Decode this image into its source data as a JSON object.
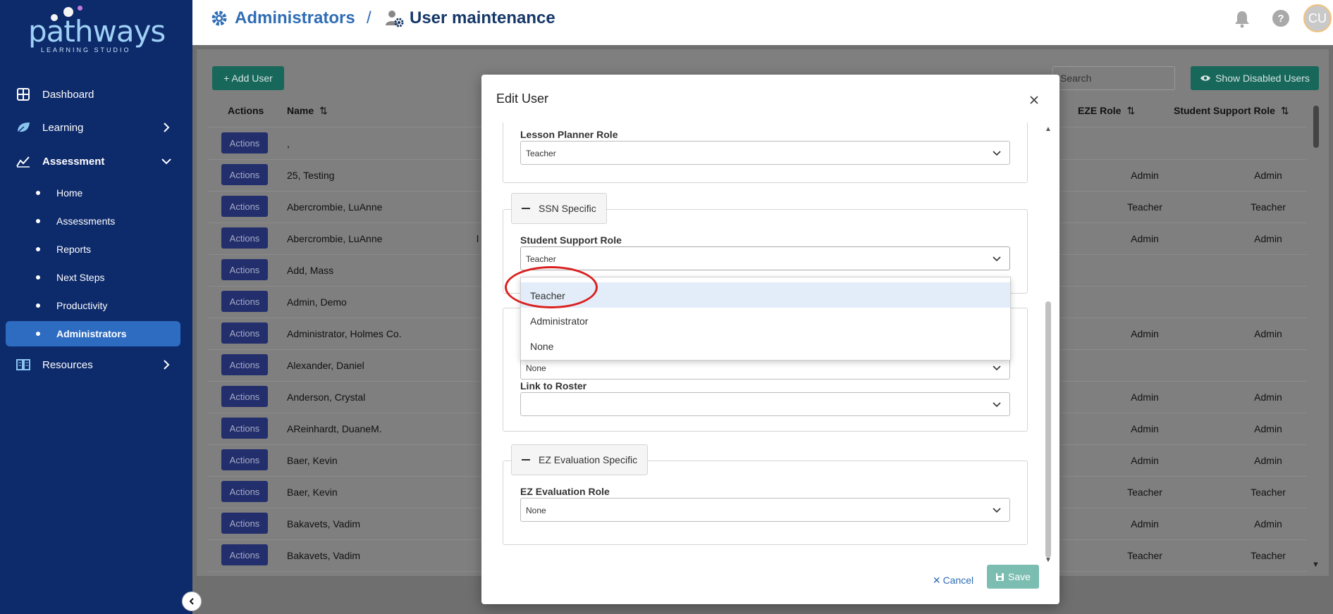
{
  "app": {
    "logo_text": "pathways",
    "logo_subtext": "LEARNING STUDIO"
  },
  "sidebar": {
    "items": [
      {
        "label": "Dashboard",
        "icon": "dashboard-icon"
      },
      {
        "label": "Learning",
        "icon": "leaf-icon",
        "chevron": "chevron-right-icon"
      },
      {
        "label": "Assessment",
        "icon": "chart-icon",
        "chevron": "chevron-down-icon"
      },
      {
        "label": "Resources",
        "icon": "book-icon",
        "chevron": "chevron-right-icon"
      }
    ],
    "sub_items": [
      "Home",
      "Assessments",
      "Reports",
      "Next Steps",
      "Productivity",
      "Administrators"
    ],
    "active_sub_item": "Administrators"
  },
  "header": {
    "crumb1": "Administrators",
    "separator": "/",
    "crumb2": "User maintenance",
    "help_label": "?",
    "avatar_initials": "CU"
  },
  "toolbar": {
    "add_user_label": "+ Add User",
    "search_placeholder": "Search",
    "show_disabled_label": "Show Disabled Users"
  },
  "table": {
    "headers": {
      "actions": "Actions",
      "name": "Name",
      "eze_role": "EZE Role",
      "student_support_role": "Student Support Role"
    },
    "action_label": "Actions",
    "rows": [
      {
        "name": ",",
        "mid": "",
        "eze": "",
        "ssr": ""
      },
      {
        "name": "25, Testing",
        "mid": "",
        "eze": "Admin",
        "ssr": "Admin"
      },
      {
        "name": "Abercrombie, LuAnne",
        "mid": "",
        "eze": "Teacher",
        "ssr": "Teacher"
      },
      {
        "name": "Abercrombie, LuAnne",
        "mid": "l",
        "eze": "Admin",
        "ssr": "Admin"
      },
      {
        "name": "Add, Mass",
        "mid": "",
        "eze": "",
        "ssr": ""
      },
      {
        "name": "Admin, Demo",
        "mid": "",
        "eze": "",
        "ssr": ""
      },
      {
        "name": "Administrator, Holmes Co.",
        "mid": "",
        "eze": "Admin",
        "ssr": "Admin"
      },
      {
        "name": "Alexander, Daniel",
        "mid": "",
        "eze": "",
        "ssr": ""
      },
      {
        "name": "Anderson, Crystal",
        "mid": "",
        "eze": "Admin",
        "ssr": "Admin"
      },
      {
        "name": "AReinhardt, DuaneM.",
        "mid": "",
        "eze": "Admin",
        "ssr": "Admin"
      },
      {
        "name": "Baer, Kevin",
        "mid": "",
        "eze": "Admin",
        "ssr": "Admin"
      },
      {
        "name": "Baer, Kevin",
        "mid": "",
        "eze": "Teacher",
        "ssr": "Teacher"
      },
      {
        "name": "Bakavets, Vadim",
        "mid": "",
        "eze": "Admin",
        "ssr": "Admin"
      },
      {
        "name": "Bakavets, Vadim",
        "mid": "",
        "eze": "Teacher",
        "ssr": "Teacher"
      }
    ]
  },
  "modal": {
    "title": "Edit User",
    "lesson_planner_label": "Lesson Planner Role",
    "lesson_planner_value": "Teacher",
    "ssn_legend": "SSN Specific",
    "student_support_label": "Student Support Role",
    "student_support_value": "Teacher",
    "dropdown_options": [
      "Teacher",
      "Administrator",
      "None"
    ],
    "hidden_select_value": "None",
    "link_to_roster_label": "Link to Roster",
    "link_to_roster_value": "",
    "eze_legend": "EZ Evaluation Specific",
    "eze_role_label": "EZ Evaluation Role",
    "eze_role_value": "None",
    "cancel_label": "Cancel",
    "save_label": "Save"
  },
  "colors": {
    "sidebar_bg": "#0d2a6b",
    "active_item": "#2d6cc0",
    "brand_blue": "#2f6db5",
    "teal_button": "#17675a",
    "action_button": "#232e6c",
    "annotation_red": "#d9201f"
  }
}
